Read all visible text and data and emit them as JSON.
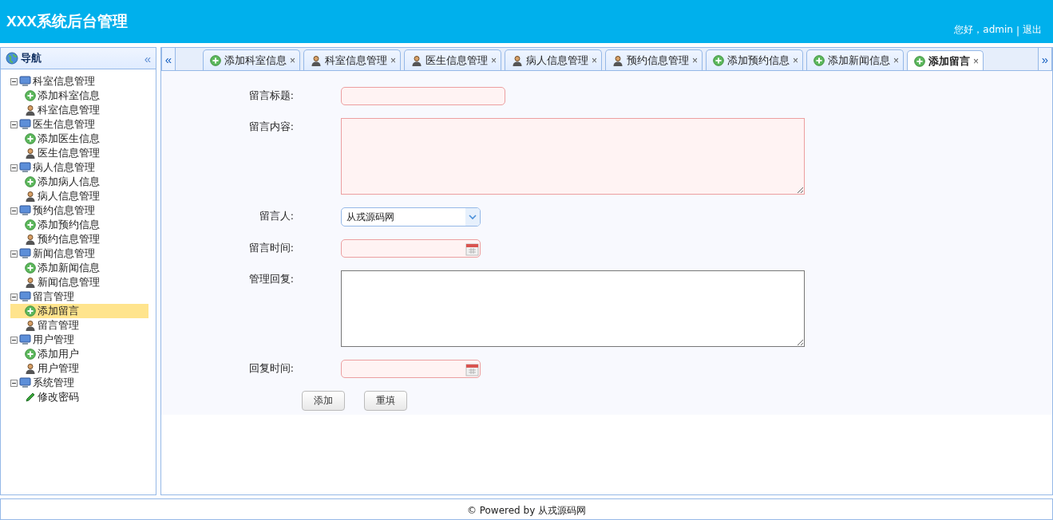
{
  "header": {
    "title": "XXX系统后台管理",
    "greeting": "您好，admin",
    "separator": "|",
    "logout": "退出"
  },
  "sidebar": {
    "title": "导航",
    "collapse": "«",
    "tree": [
      {
        "label": "科室信息管理",
        "expanded": true,
        "children": [
          {
            "label": "添加科室信息",
            "kind": "add",
            "selected": false
          },
          {
            "label": "科室信息管理",
            "kind": "manage",
            "selected": false
          }
        ]
      },
      {
        "label": "医生信息管理",
        "expanded": true,
        "children": [
          {
            "label": "添加医生信息",
            "kind": "add",
            "selected": false
          },
          {
            "label": "医生信息管理",
            "kind": "manage",
            "selected": false
          }
        ]
      },
      {
        "label": "病人信息管理",
        "expanded": true,
        "children": [
          {
            "label": "添加病人信息",
            "kind": "add",
            "selected": false
          },
          {
            "label": "病人信息管理",
            "kind": "manage",
            "selected": false
          }
        ]
      },
      {
        "label": "预约信息管理",
        "expanded": true,
        "children": [
          {
            "label": "添加预约信息",
            "kind": "add",
            "selected": false
          },
          {
            "label": "预约信息管理",
            "kind": "manage",
            "selected": false
          }
        ]
      },
      {
        "label": "新闻信息管理",
        "expanded": true,
        "children": [
          {
            "label": "添加新闻信息",
            "kind": "add",
            "selected": false
          },
          {
            "label": "新闻信息管理",
            "kind": "manage",
            "selected": false
          }
        ]
      },
      {
        "label": "留言管理",
        "expanded": true,
        "children": [
          {
            "label": "添加留言",
            "kind": "add",
            "selected": true
          },
          {
            "label": "留言管理",
            "kind": "manage",
            "selected": false
          }
        ]
      },
      {
        "label": "用户管理",
        "expanded": true,
        "children": [
          {
            "label": "添加用户",
            "kind": "add",
            "selected": false
          },
          {
            "label": "用户管理",
            "kind": "manage",
            "selected": false
          }
        ]
      },
      {
        "label": "系统管理",
        "expanded": true,
        "children": [
          {
            "label": "修改密码",
            "kind": "edit",
            "selected": false
          }
        ]
      }
    ]
  },
  "tabbar": {
    "prev": "«",
    "next": "»",
    "tabs": [
      {
        "label": "添加科室信息",
        "kind": "add",
        "selected": false,
        "close": "×"
      },
      {
        "label": "科室信息管理",
        "kind": "manage",
        "selected": false,
        "close": "×"
      },
      {
        "label": "医生信息管理",
        "kind": "manage",
        "selected": false,
        "close": "×"
      },
      {
        "label": "病人信息管理",
        "kind": "manage",
        "selected": false,
        "close": "×"
      },
      {
        "label": "预约信息管理",
        "kind": "manage",
        "selected": false,
        "close": "×"
      },
      {
        "label": "添加预约信息",
        "kind": "add",
        "selected": false,
        "close": "×"
      },
      {
        "label": "添加新闻信息",
        "kind": "add",
        "selected": false,
        "close": "×"
      },
      {
        "label": "添加留言",
        "kind": "add",
        "selected": true,
        "close": "×"
      }
    ]
  },
  "form": {
    "fields": [
      {
        "label": "留言标题:",
        "kind": "text",
        "invalid": true
      },
      {
        "label": "留言内容:",
        "kind": "textarea",
        "invalid": true
      },
      {
        "label": "留言人:",
        "kind": "select",
        "value": "从戎源码网",
        "invalid": false
      },
      {
        "label": "留言时间:",
        "kind": "date",
        "invalid": true
      },
      {
        "label": "管理回复:",
        "kind": "textarea",
        "invalid": false
      },
      {
        "label": "回复时间:",
        "kind": "date",
        "invalid": true
      }
    ],
    "buttons": [
      "添加",
      "重填"
    ]
  },
  "footer": {
    "text": "© Powered by 从戎源码网"
  }
}
